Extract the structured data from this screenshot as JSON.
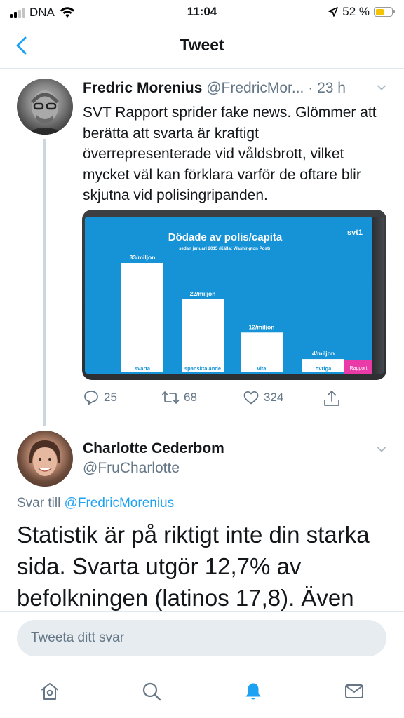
{
  "status_bar": {
    "carrier": "DNA",
    "time": "11:04",
    "battery_percent": "52 %",
    "battery_level": 0.52,
    "signal_bars_active": 2,
    "signal_bars_total": 4
  },
  "header": {
    "title": "Tweet"
  },
  "tweet": {
    "author_name": "Fredric Morenius",
    "author_handle": "@FredricMor...",
    "separator": "·",
    "time_ago": "23 h",
    "text": "SVT Rapport sprider fake news. Glömmer att berätta att svarta är kraftigt överrepresenterade vid våldsbrott, vilket mycket väl kan förklara varför de oftare blir skjutna vid polisingripanden.",
    "media": {
      "brand": "svt1",
      "program_tag": "Rapport"
    },
    "actions": {
      "replies": "25",
      "retweets": "68",
      "likes": "324"
    }
  },
  "chart_data": {
    "type": "bar",
    "title": "Dödade av polis/capita",
    "subtitle": "sedan januari 2015 (Källa: Washington Post)",
    "categories": [
      "svarta",
      "spansktalande",
      "vita",
      "övriga"
    ],
    "values": [
      33,
      22,
      12,
      4
    ],
    "value_labels": [
      "33/miljon",
      "22/miljon",
      "12/miljon",
      "4/miljon"
    ],
    "ylim": [
      0,
      33
    ],
    "grid": false,
    "colors": {
      "bar": "#ffffff",
      "background": "#1593d6",
      "tag": "#e93aa8"
    }
  },
  "reply": {
    "author_name": "Charlotte Cederbom",
    "author_handle": "@FruCharlotte",
    "reply_prefix": "Svar till",
    "reply_to_handle": "@FredricMorenius",
    "text": "Statistik är på riktigt inte din starka sida. Svarta utgör 12,7% av befolkningen (latinos 17,8). Även om"
  },
  "composer": {
    "placeholder": "Tweeta ditt svar"
  },
  "tabs": [
    {
      "icon": "home-icon"
    },
    {
      "icon": "search-icon"
    },
    {
      "icon": "bell-icon",
      "active": true
    },
    {
      "icon": "mail-icon"
    }
  ],
  "colors": {
    "accent": "#1da1f2",
    "muted": "#657786",
    "text": "#14171a",
    "divider": "#e1e8ed"
  }
}
